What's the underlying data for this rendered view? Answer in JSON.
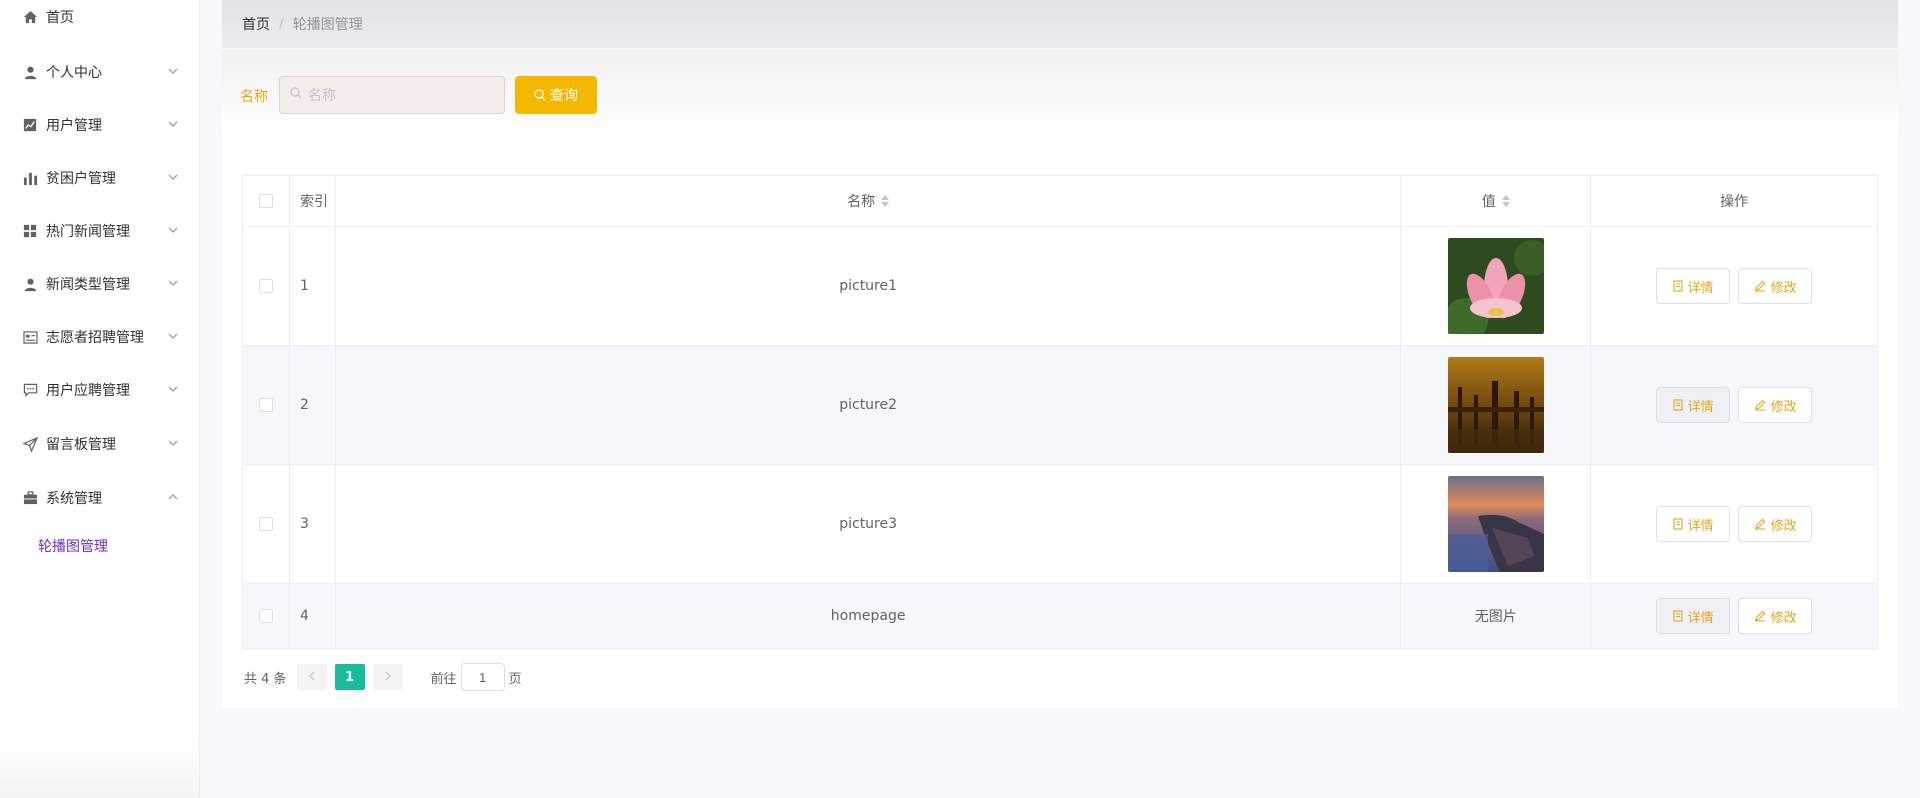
{
  "sidebar": {
    "items": [
      {
        "label": "首页",
        "icon": "home-icon"
      },
      {
        "label": "个人中心",
        "icon": "user-icon"
      },
      {
        "label": "用户管理",
        "icon": "chart-icon"
      },
      {
        "label": "贫困户管理",
        "icon": "bar-chart-icon"
      },
      {
        "label": "热门新闻管理",
        "icon": "grid-icon"
      },
      {
        "label": "新闻类型管理",
        "icon": "user-icon"
      },
      {
        "label": "志愿者招聘管理",
        "icon": "id-card-icon"
      },
      {
        "label": "用户应聘管理",
        "icon": "chat-icon"
      },
      {
        "label": "留言板管理",
        "icon": "send-icon"
      },
      {
        "label": "系统管理",
        "icon": "briefcase-icon"
      }
    ],
    "submenu": {
      "label": "轮播图管理"
    }
  },
  "breadcrumb": {
    "home": "首页",
    "separator": "/",
    "current": "轮播图管理"
  },
  "search": {
    "label": "名称",
    "placeholder": "名称",
    "button": "查询"
  },
  "table": {
    "headers": {
      "index": "索引",
      "name": "名称",
      "value": "值",
      "actions": "操作"
    },
    "rows": [
      {
        "index": "1",
        "name": "picture1",
        "value_image": "lotus-flower",
        "value_text": ""
      },
      {
        "index": "2",
        "name": "picture2",
        "value_image": "sunset-pier",
        "value_text": ""
      },
      {
        "index": "3",
        "name": "picture3",
        "value_image": "coastal-sunset",
        "value_text": ""
      },
      {
        "index": "4",
        "name": "homepage",
        "value_image": "",
        "value_text": "无图片"
      }
    ],
    "detail_label": "详情",
    "edit_label": "修改"
  },
  "pagination": {
    "total": "共 4 条",
    "current_page": "1",
    "goto_prefix": "前往",
    "goto_value": "1",
    "goto_suffix": "页"
  },
  "colors": {
    "accent": "#f5b800",
    "pager_active": "#1abc9c",
    "submenu_active": "#6b2fb3"
  }
}
